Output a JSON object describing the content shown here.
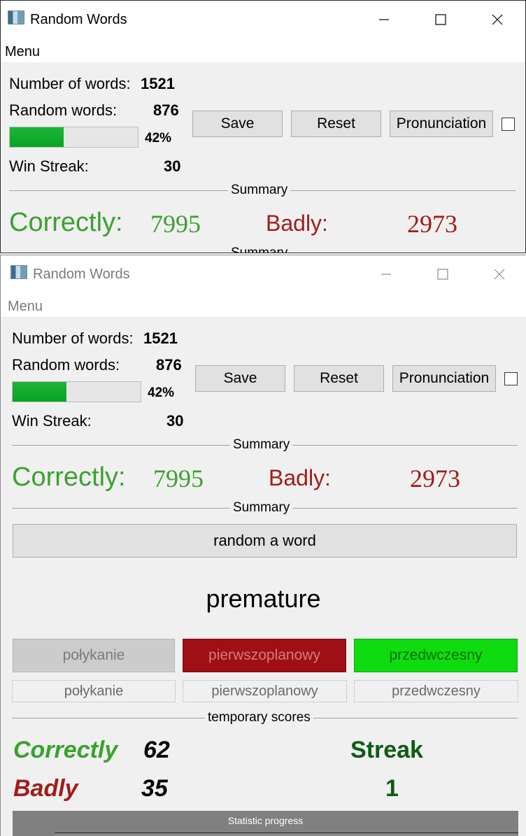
{
  "window_back": {
    "title": "Random Words",
    "menu": "Menu",
    "number_of_words_label": "Number of words:",
    "number_of_words": "1521",
    "random_words_label": "Random words:",
    "random_words": "876",
    "progress_percent": 42,
    "progress_text": "42%",
    "win_streak_label": "Win Streak:",
    "win_streak": "30",
    "save_label": "Save",
    "reset_label": "Reset",
    "pronunciation_label": "Pronunciation",
    "pronunciation_checked": false,
    "summary_label": "Summary",
    "correctly_label": "Correctly:",
    "correctly_value": "7995",
    "badly_label": "Badly:",
    "badly_value": "2973",
    "summary_label_2": "Summary"
  },
  "window_front": {
    "title": "Random Words",
    "menu": "Menu",
    "number_of_words_label": "Number of words:",
    "number_of_words": "1521",
    "random_words_label": "Random words:",
    "random_words": "876",
    "progress_percent": 42,
    "progress_text": "42%",
    "win_streak_label": "Win Streak:",
    "win_streak": "30",
    "save_label": "Save",
    "reset_label": "Reset",
    "pronunciation_label": "Pronunciation",
    "pronunciation_checked": false,
    "summary_label": "Summary",
    "correctly_label": "Correctly:",
    "correctly_value": "7995",
    "badly_label": "Badly:",
    "badly_value": "2973",
    "summary_label_2": "Summary",
    "random_word_button": "random a word",
    "current_word": "premature",
    "answers": [
      {
        "label": "połykanie",
        "state": "neutral"
      },
      {
        "label": "pierwszoplanowy",
        "state": "wrong"
      },
      {
        "label": "przedwczesny",
        "state": "correct"
      }
    ],
    "previous_answers": [
      "połykanie",
      "pierwszoplanowy",
      "przedwczesny"
    ],
    "temporary_scores_label": "temporary scores",
    "temp_correctly_label": "Correctly",
    "temp_correctly_value": "62",
    "temp_badly_label": "Badly",
    "temp_badly_value": "35",
    "streak_label": "Streak",
    "streak_value": "1",
    "statistic_progress_label": "Statistic progress"
  },
  "colors": {
    "green_text": "#3aa12f",
    "red_text": "#a11c1c",
    "streak_green": "#0c5c14",
    "answer_wrong_bg": "#a00e16",
    "answer_correct_bg": "#0fdc0f",
    "progress_fill": "#06a422"
  },
  "icons": {
    "app": "app-window-icon",
    "minimize": "minimize-icon",
    "maximize": "maximize-icon",
    "close": "close-icon"
  }
}
